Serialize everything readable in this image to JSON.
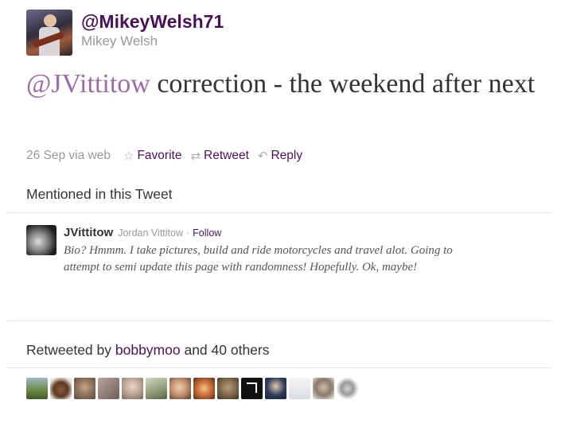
{
  "tweet": {
    "screen_name": "@MikeyWelsh71",
    "full_name": "Mikey Welsh",
    "text_mention": "@JVittitow",
    "text_body": " correction - the weekend after next",
    "timestamp": "26 Sep via web"
  },
  "actions": {
    "favorite": {
      "label": "Favorite",
      "icon": "star-icon"
    },
    "retweet": {
      "label": "Retweet",
      "icon": "retweet-icon"
    },
    "reply": {
      "label": "Reply",
      "icon": "reply-arrow-icon"
    }
  },
  "mentioned": {
    "title": "Mentioned in this Tweet",
    "user": {
      "screen_name": "JVittitow",
      "full_name": "Jordan Vittitow",
      "separator": "·",
      "follow_label": "Follow",
      "bio": "Bio? Hmmm. I take pictures, build and ride motorcycles and travel alot. Going to attempt to semi update this page with randomness! Hopefully. Ok, maybe!"
    }
  },
  "retweeted": {
    "prefix": "Retweeted by ",
    "user": "bobbymoo",
    "suffix": " and 40 others"
  },
  "colors": {
    "link": "#4a1157",
    "mention": "#9b6ba6",
    "muted": "#999999"
  }
}
